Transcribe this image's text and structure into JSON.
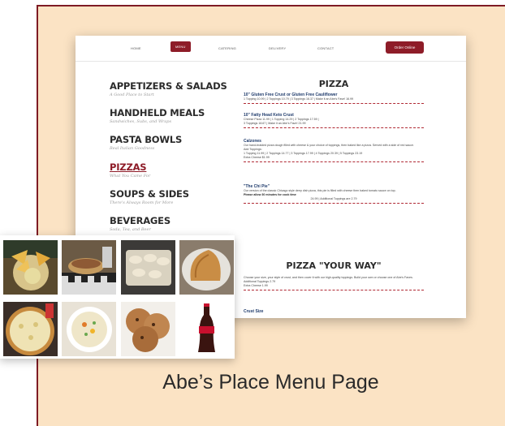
{
  "nav": {
    "items": [
      "HOME",
      "MENU",
      "CATERING",
      "DELIVERY",
      "CONTACT"
    ],
    "active": "MENU",
    "order_button": "Order Online"
  },
  "categories": [
    {
      "title": "APPETIZERS & SALADS",
      "subtitle": "A Good Place to Start"
    },
    {
      "title": "HANDHELD MEALS",
      "subtitle": "Sandwiches, Subs, and Wraps"
    },
    {
      "title": "PASTA BOWLS",
      "subtitle": "Real Italian Goodness"
    },
    {
      "title": "PIZZAS",
      "subtitle": "What You Came For"
    },
    {
      "title": "SOUPS & SIDES",
      "subtitle": "There's Always Room for More"
    },
    {
      "title": "BEVERAGES",
      "subtitle": "Soda, Tea, and Beer"
    }
  ],
  "pizza": {
    "heading": "PIZZA",
    "items": [
      {
        "name": "10\" Gluten Free Crust or Gluten Free Cauliflower",
        "lines": [
          "1 Topping 10.99 | 2 Toppings 10.79 | 3 Toppings 16.37 | Make it an Abe's Fave! 16.99"
        ]
      },
      {
        "name": "10\" Fatty Head Keto Crust",
        "lines": [
          "Cheese Pizza 11.99 | 1 Topping 14.29 | 2 Toppings 17.59 |",
          "3 Toppings 18.67 | Make it an Abe's Fave! 21.99"
        ]
      },
      {
        "name": "Calzones",
        "lines": [
          "Our hand-braided pizza dough filled with cheese & your choice of toppings, then baked like a pizza. Served with a side of red sauce.",
          "Add Toppings:",
          "1 Topping 11.99 | 2 Toppings 14.77 | 3 Toppings 17.99 | 4 Toppings 20.39 | 5 Toppings 23.19",
          "Extra Cheese $1.99"
        ]
      },
      {
        "name": "\"The Chi Pie\"",
        "lines": [
          "Our version of the classic Chicago style deep dish pizza, this pie is filled with cheese then baked tomato sauce on top.",
          "Please allow 30 minutes for cook time",
          "24.99 | Additional Toppings are 2.79"
        ]
      }
    ]
  },
  "pizza_your_way": {
    "heading": "PIZZA \"YOUR WAY\"",
    "lines": [
      "Choose your size, your style of crust, and then cover it with our high-quality toppings. Build your own or choose one of Abe's Faves.",
      "Additional Toppings 2.79",
      "Extra Cheese 1.99"
    ],
    "crust_label": "Crust Size"
  },
  "photos": [
    "nachos-photo",
    "sandwich-photo",
    "ravioli-photo",
    "calzone-photo",
    "pizza-photo",
    "soup-photo",
    "cookies-photo",
    "cola-bottle-photo"
  ],
  "caption": "Abe’s Place Menu Page",
  "colors": {
    "accent": "#8e1c28",
    "background": "#fbe3c4",
    "link": "#1e3a6b"
  }
}
